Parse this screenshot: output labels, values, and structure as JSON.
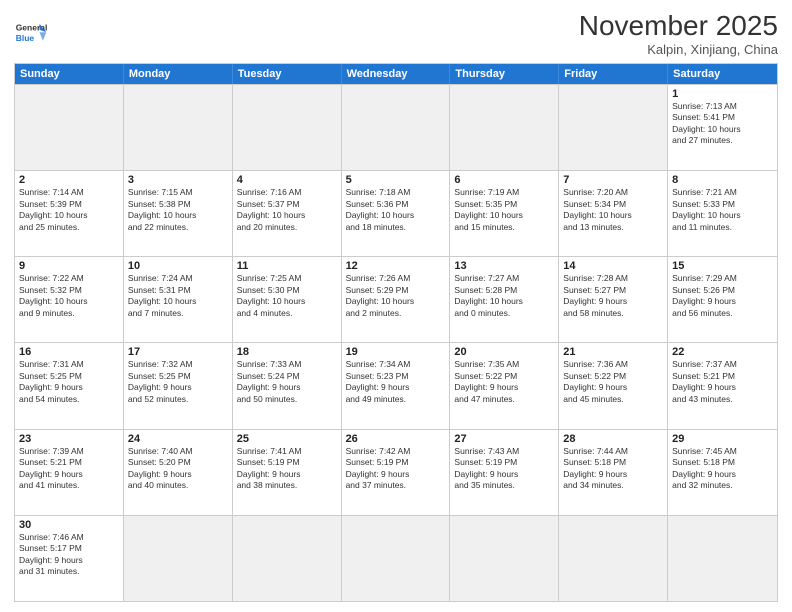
{
  "header": {
    "logo_general": "General",
    "logo_blue": "Blue",
    "month": "November 2025",
    "location": "Kalpin, Xinjiang, China"
  },
  "weekdays": [
    "Sunday",
    "Monday",
    "Tuesday",
    "Wednesday",
    "Thursday",
    "Friday",
    "Saturday"
  ],
  "rows": [
    [
      {
        "day": "",
        "text": "",
        "empty": true
      },
      {
        "day": "",
        "text": "",
        "empty": true
      },
      {
        "day": "",
        "text": "",
        "empty": true
      },
      {
        "day": "",
        "text": "",
        "empty": true
      },
      {
        "day": "",
        "text": "",
        "empty": true
      },
      {
        "day": "",
        "text": "",
        "empty": true
      },
      {
        "day": "1",
        "text": "Sunrise: 7:13 AM\nSunset: 5:41 PM\nDaylight: 10 hours\nand 27 minutes.",
        "empty": false
      }
    ],
    [
      {
        "day": "2",
        "text": "Sunrise: 7:14 AM\nSunset: 5:39 PM\nDaylight: 10 hours\nand 25 minutes.",
        "empty": false
      },
      {
        "day": "3",
        "text": "Sunrise: 7:15 AM\nSunset: 5:38 PM\nDaylight: 10 hours\nand 22 minutes.",
        "empty": false
      },
      {
        "day": "4",
        "text": "Sunrise: 7:16 AM\nSunset: 5:37 PM\nDaylight: 10 hours\nand 20 minutes.",
        "empty": false
      },
      {
        "day": "5",
        "text": "Sunrise: 7:18 AM\nSunset: 5:36 PM\nDaylight: 10 hours\nand 18 minutes.",
        "empty": false
      },
      {
        "day": "6",
        "text": "Sunrise: 7:19 AM\nSunset: 5:35 PM\nDaylight: 10 hours\nand 15 minutes.",
        "empty": false
      },
      {
        "day": "7",
        "text": "Sunrise: 7:20 AM\nSunset: 5:34 PM\nDaylight: 10 hours\nand 13 minutes.",
        "empty": false
      },
      {
        "day": "8",
        "text": "Sunrise: 7:21 AM\nSunset: 5:33 PM\nDaylight: 10 hours\nand 11 minutes.",
        "empty": false
      }
    ],
    [
      {
        "day": "9",
        "text": "Sunrise: 7:22 AM\nSunset: 5:32 PM\nDaylight: 10 hours\nand 9 minutes.",
        "empty": false
      },
      {
        "day": "10",
        "text": "Sunrise: 7:24 AM\nSunset: 5:31 PM\nDaylight: 10 hours\nand 7 minutes.",
        "empty": false
      },
      {
        "day": "11",
        "text": "Sunrise: 7:25 AM\nSunset: 5:30 PM\nDaylight: 10 hours\nand 4 minutes.",
        "empty": false
      },
      {
        "day": "12",
        "text": "Sunrise: 7:26 AM\nSunset: 5:29 PM\nDaylight: 10 hours\nand 2 minutes.",
        "empty": false
      },
      {
        "day": "13",
        "text": "Sunrise: 7:27 AM\nSunset: 5:28 PM\nDaylight: 10 hours\nand 0 minutes.",
        "empty": false
      },
      {
        "day": "14",
        "text": "Sunrise: 7:28 AM\nSunset: 5:27 PM\nDaylight: 9 hours\nand 58 minutes.",
        "empty": false
      },
      {
        "day": "15",
        "text": "Sunrise: 7:29 AM\nSunset: 5:26 PM\nDaylight: 9 hours\nand 56 minutes.",
        "empty": false
      }
    ],
    [
      {
        "day": "16",
        "text": "Sunrise: 7:31 AM\nSunset: 5:25 PM\nDaylight: 9 hours\nand 54 minutes.",
        "empty": false
      },
      {
        "day": "17",
        "text": "Sunrise: 7:32 AM\nSunset: 5:25 PM\nDaylight: 9 hours\nand 52 minutes.",
        "empty": false
      },
      {
        "day": "18",
        "text": "Sunrise: 7:33 AM\nSunset: 5:24 PM\nDaylight: 9 hours\nand 50 minutes.",
        "empty": false
      },
      {
        "day": "19",
        "text": "Sunrise: 7:34 AM\nSunset: 5:23 PM\nDaylight: 9 hours\nand 49 minutes.",
        "empty": false
      },
      {
        "day": "20",
        "text": "Sunrise: 7:35 AM\nSunset: 5:22 PM\nDaylight: 9 hours\nand 47 minutes.",
        "empty": false
      },
      {
        "day": "21",
        "text": "Sunrise: 7:36 AM\nSunset: 5:22 PM\nDaylight: 9 hours\nand 45 minutes.",
        "empty": false
      },
      {
        "day": "22",
        "text": "Sunrise: 7:37 AM\nSunset: 5:21 PM\nDaylight: 9 hours\nand 43 minutes.",
        "empty": false
      }
    ],
    [
      {
        "day": "23",
        "text": "Sunrise: 7:39 AM\nSunset: 5:21 PM\nDaylight: 9 hours\nand 41 minutes.",
        "empty": false
      },
      {
        "day": "24",
        "text": "Sunrise: 7:40 AM\nSunset: 5:20 PM\nDaylight: 9 hours\nand 40 minutes.",
        "empty": false
      },
      {
        "day": "25",
        "text": "Sunrise: 7:41 AM\nSunset: 5:19 PM\nDaylight: 9 hours\nand 38 minutes.",
        "empty": false
      },
      {
        "day": "26",
        "text": "Sunrise: 7:42 AM\nSunset: 5:19 PM\nDaylight: 9 hours\nand 37 minutes.",
        "empty": false
      },
      {
        "day": "27",
        "text": "Sunrise: 7:43 AM\nSunset: 5:19 PM\nDaylight: 9 hours\nand 35 minutes.",
        "empty": false
      },
      {
        "day": "28",
        "text": "Sunrise: 7:44 AM\nSunset: 5:18 PM\nDaylight: 9 hours\nand 34 minutes.",
        "empty": false
      },
      {
        "day": "29",
        "text": "Sunrise: 7:45 AM\nSunset: 5:18 PM\nDaylight: 9 hours\nand 32 minutes.",
        "empty": false
      }
    ],
    [
      {
        "day": "30",
        "text": "Sunrise: 7:46 AM\nSunset: 5:17 PM\nDaylight: 9 hours\nand 31 minutes.",
        "empty": false
      },
      {
        "day": "",
        "text": "",
        "empty": true
      },
      {
        "day": "",
        "text": "",
        "empty": true
      },
      {
        "day": "",
        "text": "",
        "empty": true
      },
      {
        "day": "",
        "text": "",
        "empty": true
      },
      {
        "day": "",
        "text": "",
        "empty": true
      },
      {
        "day": "",
        "text": "",
        "empty": true
      }
    ]
  ]
}
